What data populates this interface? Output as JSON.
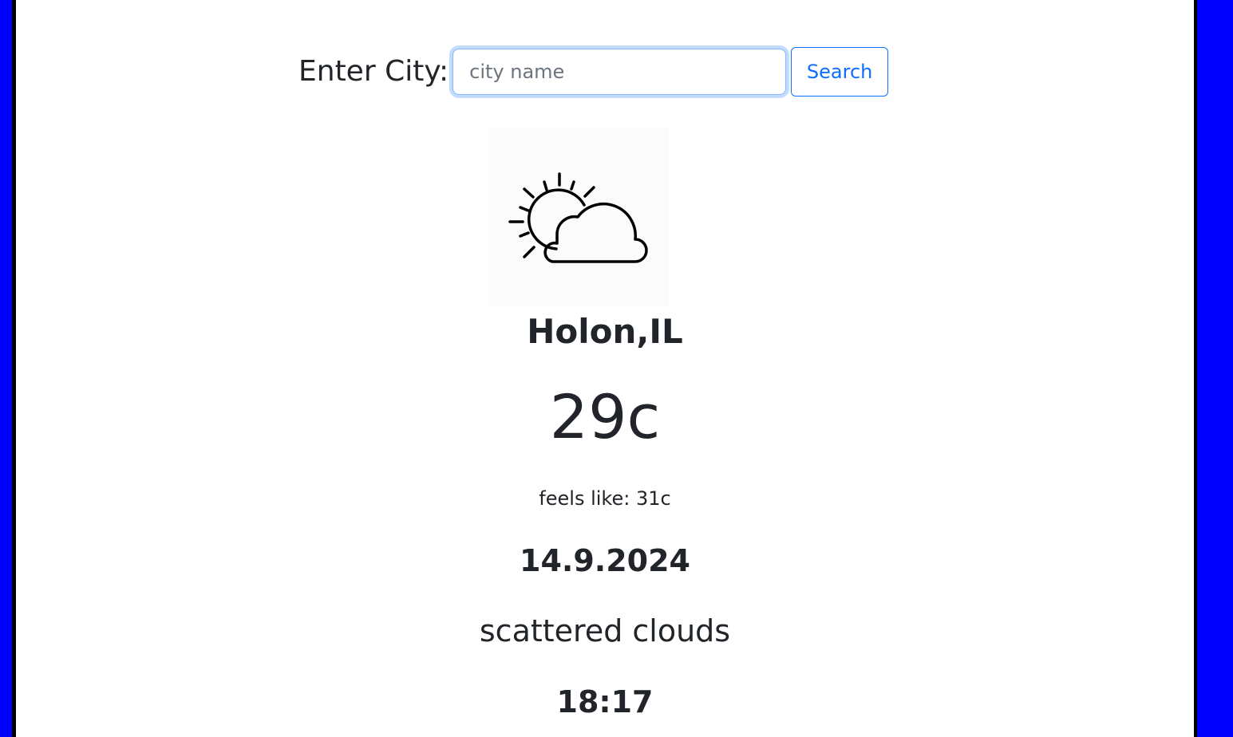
{
  "search": {
    "label": "Enter City:",
    "placeholder": "city name",
    "value": "",
    "button_label": "Search"
  },
  "weather": {
    "icon": "partly-cloudy-icon",
    "location": "Holon,IL",
    "temperature": "29c",
    "feels_like_label": "feels like:",
    "feels_like_value": "31c",
    "date": "14.9.2024",
    "description": "scattered clouds",
    "time": "18:17"
  },
  "colors": {
    "frame": "#0000ff",
    "accent": "#0d6efd",
    "text": "#212529"
  }
}
